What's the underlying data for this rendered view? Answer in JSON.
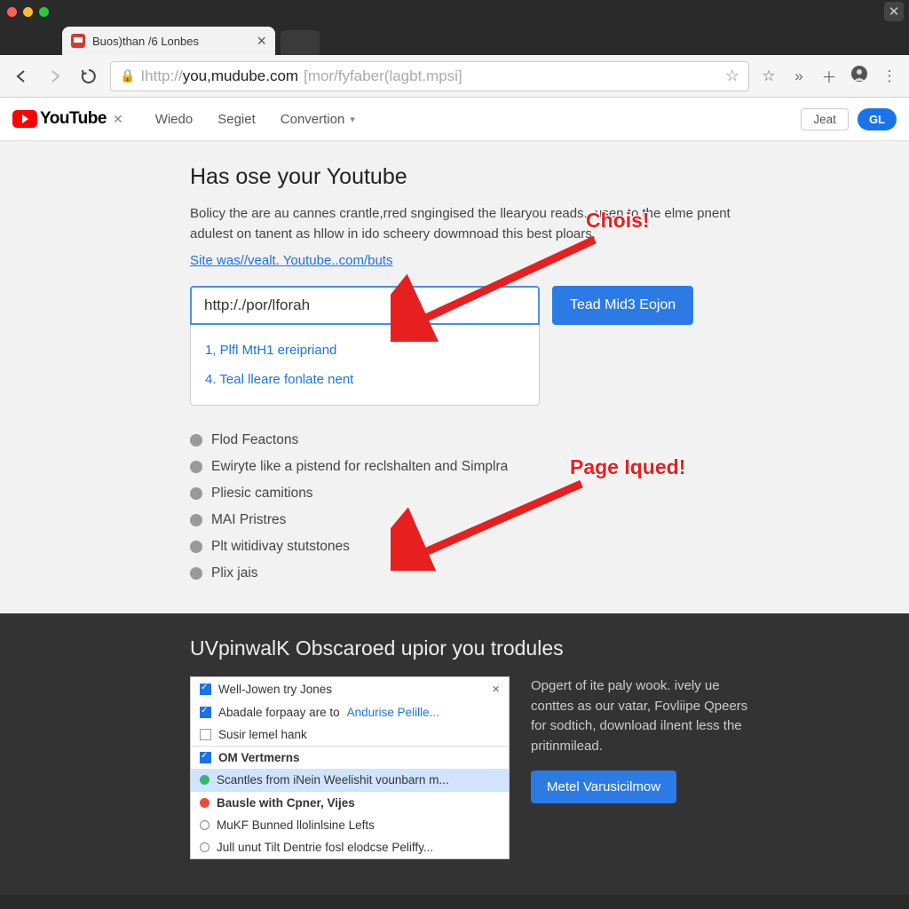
{
  "tab": {
    "title": "Buos)than /6 Lonbes"
  },
  "address": {
    "protocol": "Ihttp://",
    "host": "you,mudube.com",
    "path": "[mor/fyfaber(lagbt.mpsi]"
  },
  "yt": {
    "brand": "YouTube",
    "nav": [
      "Wiedo",
      "Segiet",
      "Convertion"
    ],
    "right_outline": "Jeat",
    "right_pill": "GL"
  },
  "page": {
    "heading": "Has ose your Youtube",
    "description": "Bolicy the are au cannes crantle,rred sngingised the llearyou reads., usen to the elme pnent adulest on tanent as hllow in ido scheery dowmnoad this best ploars.",
    "site_link": "Site was//vealt. Youtube..com/buts",
    "input_value": "http:/./por/lforah",
    "button_label": "Tead Mid3 Eojon",
    "dropdown": [
      "1, Plfl MtH1 ereipriand",
      "4. Teal lleare fonlate nent"
    ],
    "options": [
      "Flod Feactons",
      "Ewiryte like a pistend for reclshalten and Simplra",
      "Pliesic camitions",
      "MAI Pristres",
      "Plt witidivay stutstones",
      "Plix jais"
    ]
  },
  "annotations": {
    "chois": "Chois!",
    "page_iqued": "Page Iqued!"
  },
  "bottom": {
    "heading": "UVpinwalK Obscaroed upior you trodules",
    "panel": [
      {
        "type": "chk",
        "text": "Well-Jowen try Jones",
        "close": true
      },
      {
        "type": "chk",
        "text": "Abadale forpaay are to",
        "link": "Andurise Pelille..."
      },
      {
        "type": "box",
        "text": "Susir lemel hank"
      },
      {
        "type": "chk",
        "bold": true,
        "text": "OM Vertmerns",
        "sep": true
      },
      {
        "type": "circle-green",
        "text": "Scantles from iNein Weelishit vounbarn m...",
        "hl": true
      },
      {
        "type": "circle-red",
        "bold": true,
        "text": "Bausle with Cpner, Vijes",
        "sep": true
      },
      {
        "type": "dot",
        "text": "MuKF Bunned llolinlsine Lefts"
      },
      {
        "type": "dot",
        "text": "Jull unut Tilt Dentrie fosl elodcse Peliffy..."
      }
    ],
    "side_text": "Opgert of ite paly wook. ively ue conttes as our vatar, Fovliipe Qpeers for sodtich, download ilnent less the pritinmilead.",
    "side_button": "Metel Varusicilmow"
  }
}
